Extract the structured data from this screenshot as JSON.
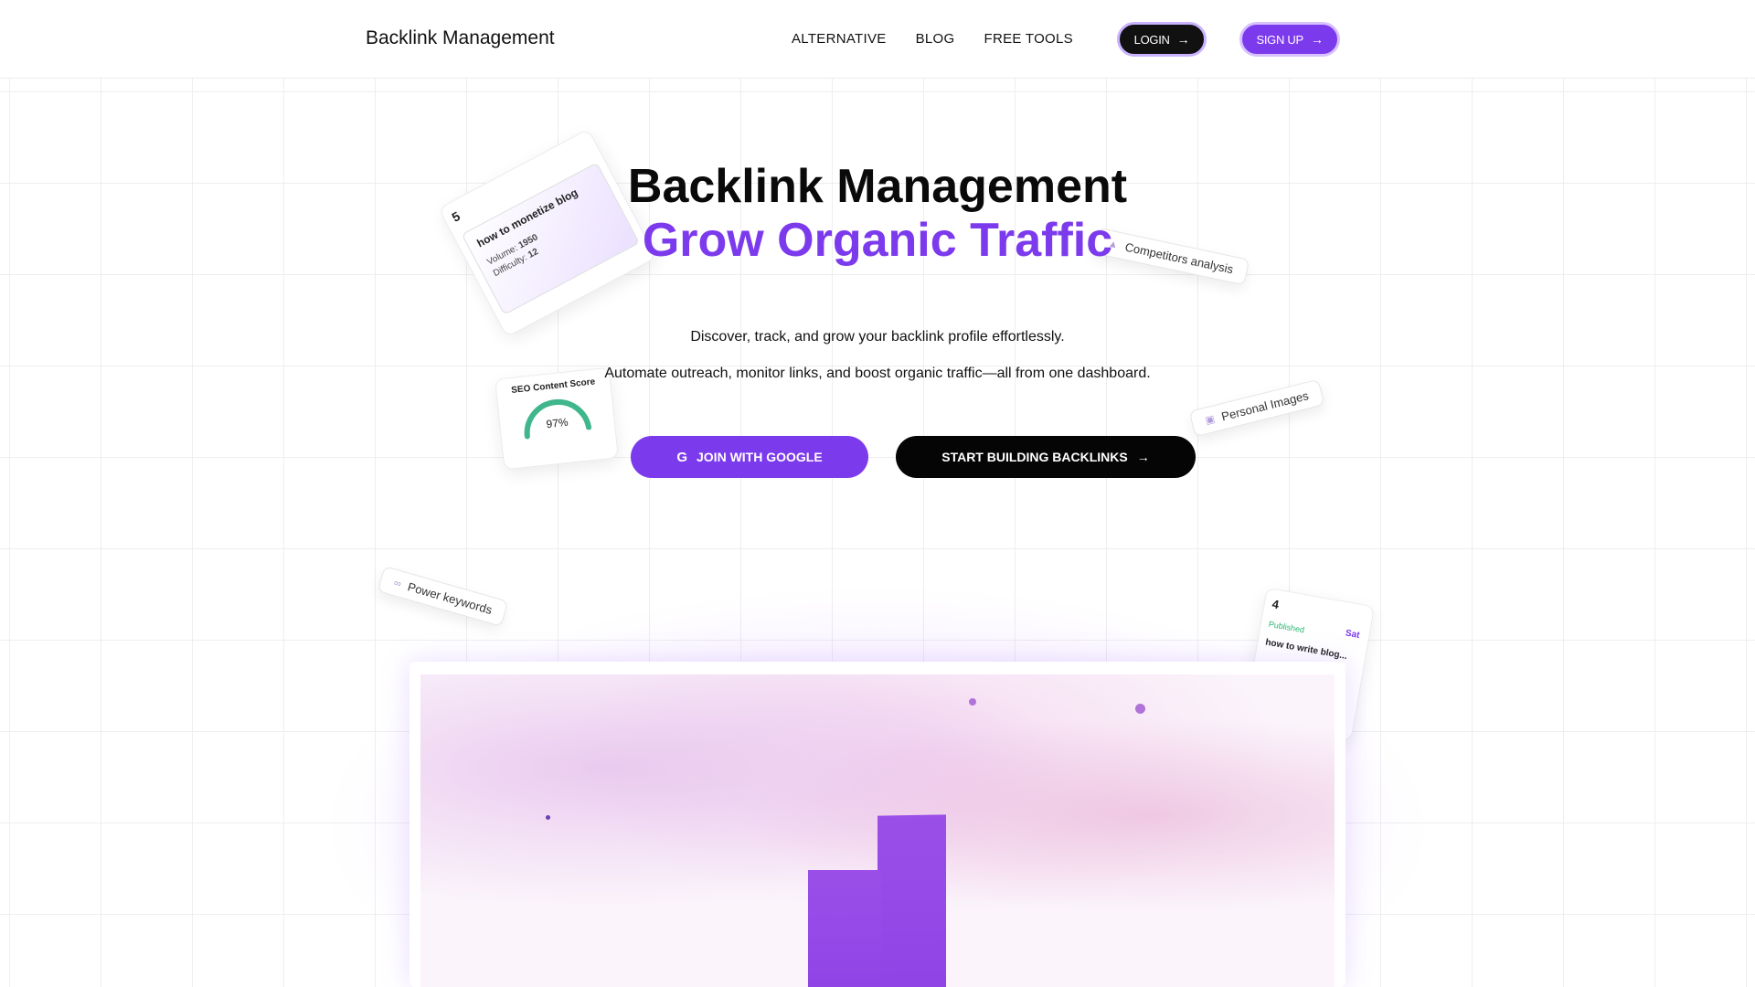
{
  "nav": {
    "brand": "Backlink Management",
    "links": [
      "ALTERNATIVE",
      "BLOG",
      "FREE TOOLS"
    ],
    "login_label": "LOGIN",
    "signup_label": "SIGN UP"
  },
  "hero": {
    "title": "Backlink Management",
    "subtitle": "Grow Organic Traffic",
    "para1": "Discover, track, and grow your backlink profile effortlessly.",
    "para2": "Automate outreach, monitor links, and boost organic traffic—all from one dashboard.",
    "cta_google": "JOIN WITH GOOGLE",
    "cta_build": "START BUILDING BACKLINKS"
  },
  "cards": {
    "keyword": {
      "number": "5",
      "keyword": "how to monetize blog",
      "volume_label": "Volume:",
      "volume": "1950",
      "difficulty_label": "Difficulty:",
      "difficulty": "12"
    },
    "seo": {
      "title": "SEO Content Score",
      "score": "97%",
      "score_value": 0.97
    },
    "competitors": "Competitors analysis",
    "personal_images": "Personal Images",
    "power_keywords": "Power keywords",
    "published": {
      "number": "4",
      "day": "Sat",
      "status": "Published",
      "title": "how to write blog..."
    }
  },
  "colors": {
    "accent": "#7c3aed",
    "dark": "#050505",
    "score_green": "#3fb68b"
  },
  "icons": {
    "arrow": "arrow-right-icon",
    "google": "google-icon"
  }
}
